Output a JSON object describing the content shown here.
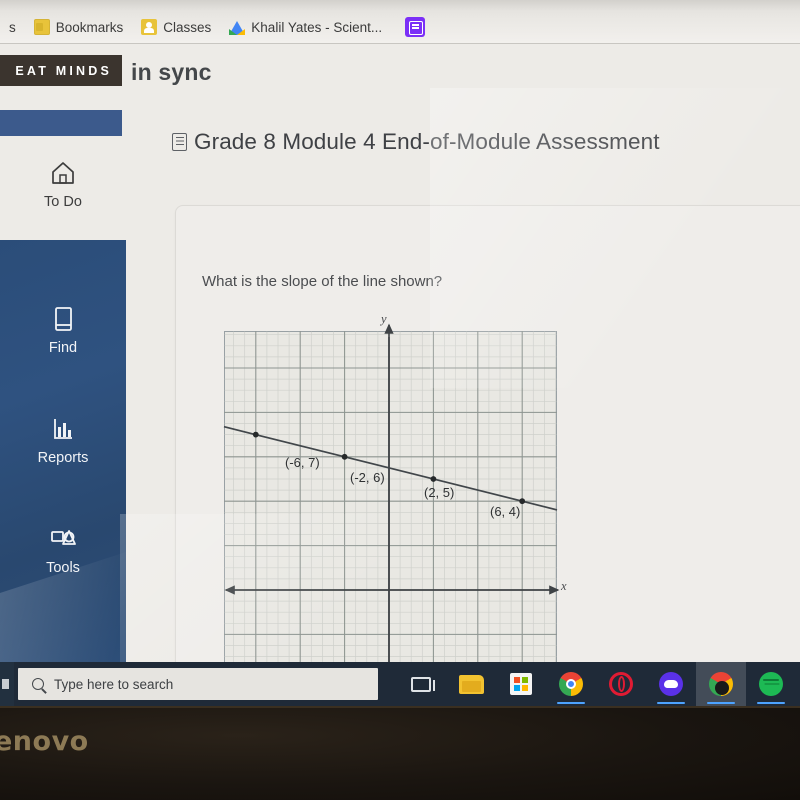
{
  "browser": {
    "bookmarks": [
      {
        "label": "s",
        "icon": "partial-bookmark-icon"
      },
      {
        "label": "Bookmarks",
        "icon": "folder-icon"
      },
      {
        "label": "Classes",
        "icon": "google-classroom-icon"
      },
      {
        "label": "Khalil Yates - Scient...",
        "icon": "google-drive-icon"
      }
    ],
    "bookmark_overflow_icon": "list-icon"
  },
  "app": {
    "brand_logo_text": "EAT MINDS",
    "brand_name": "in sync",
    "page_title": "Grade 8 Module 4 End-of-Module Assessment",
    "page_title_icon": "document-icon",
    "sidebar": {
      "items": [
        {
          "label": "To Do",
          "icon": "home-icon",
          "theme": "light"
        },
        {
          "label": "Find",
          "icon": "book-icon",
          "theme": "dark"
        },
        {
          "label": "Reports",
          "icon": "bar-chart-icon",
          "theme": "dark"
        },
        {
          "label": "Tools",
          "icon": "tools-icon",
          "theme": "dark"
        }
      ],
      "accent_color": "#2f5280",
      "highlight_bar_color": "#3c5a8c"
    },
    "question": {
      "prompt": "What is the slope of the line shown?"
    }
  },
  "chart_data": {
    "type": "line",
    "title": "",
    "xlabel": "x",
    "ylabel": "y",
    "xlim": [
      -9,
      9
    ],
    "ylim": [
      -9,
      9
    ],
    "grid": true,
    "minor_grid": true,
    "major_grid_step": 2,
    "minor_grid_step": 0.5,
    "legend": "none",
    "series": [
      {
        "name": "line",
        "slope": -0.25,
        "intercept": 5.5,
        "x": [
          -9,
          9
        ],
        "y": [
          7.75,
          3.25
        ],
        "points": [
          {
            "x": -6,
            "y": 7,
            "label": "(-6, 7)"
          },
          {
            "x": -2,
            "y": 6,
            "label": "(-2, 6)"
          },
          {
            "x": 2,
            "y": 5,
            "label": "(2, 5)"
          },
          {
            "x": 6,
            "y": 4,
            "label": "(6, 4)"
          }
        ]
      }
    ],
    "annotations": [
      "(-6, 7)",
      "(-2, 6)",
      "(2, 5)",
      "(6, 4)"
    ]
  },
  "taskbar": {
    "search_placeholder": "Type here to search",
    "search_icon": "search-icon",
    "start_icon": "windows-start-icon",
    "items": [
      {
        "name": "task-view",
        "icon": "task-view-icon",
        "active": false,
        "running": false
      },
      {
        "name": "file-explorer",
        "icon": "folder-icon",
        "active": false,
        "running": false
      },
      {
        "name": "microsoft-store",
        "icon": "microsoft-store-icon",
        "active": false,
        "running": false
      },
      {
        "name": "chrome",
        "icon": "chrome-icon",
        "active": false,
        "running": true
      },
      {
        "name": "opera",
        "icon": "opera-icon",
        "active": false,
        "running": false
      },
      {
        "name": "discord",
        "icon": "discord-icon",
        "active": false,
        "running": true
      },
      {
        "name": "chrome-window",
        "icon": "chrome-icon",
        "active": true,
        "running": true
      },
      {
        "name": "spotify",
        "icon": "spotify-icon",
        "active": false,
        "running": true
      }
    ]
  },
  "device": {
    "brand_text": "enovo"
  }
}
